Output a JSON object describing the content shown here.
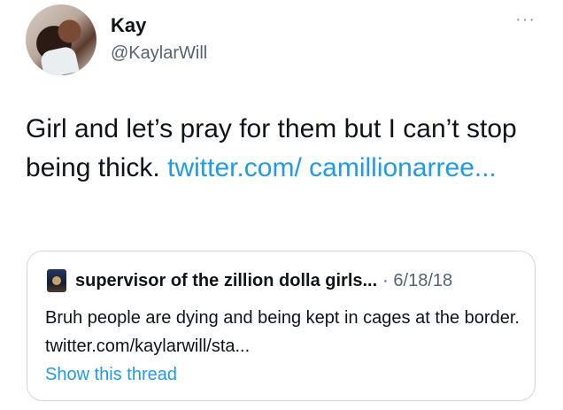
{
  "author": {
    "name": "Kay",
    "handle": "@KaylarWill",
    "avatar_icon": "profile-photo"
  },
  "more_icon": "ellipsis-icon",
  "tweet": {
    "text": "Girl and let’s pray for them but I can’t stop being thick.",
    "link_text": "twitter.com/ camillionarree..."
  },
  "quoted": {
    "author_name": "supervisor of the zillion dolla girls...",
    "date": "· 6/18/18",
    "text": "Bruh people are dying and being kept in cages at the border. twitter.com/kaylarwill/sta...",
    "show_thread": "Show this thread"
  },
  "colors": {
    "link": "#1d9bf0",
    "text": "#0f1419",
    "secondary": "#536471",
    "border": "#cfd9de"
  }
}
